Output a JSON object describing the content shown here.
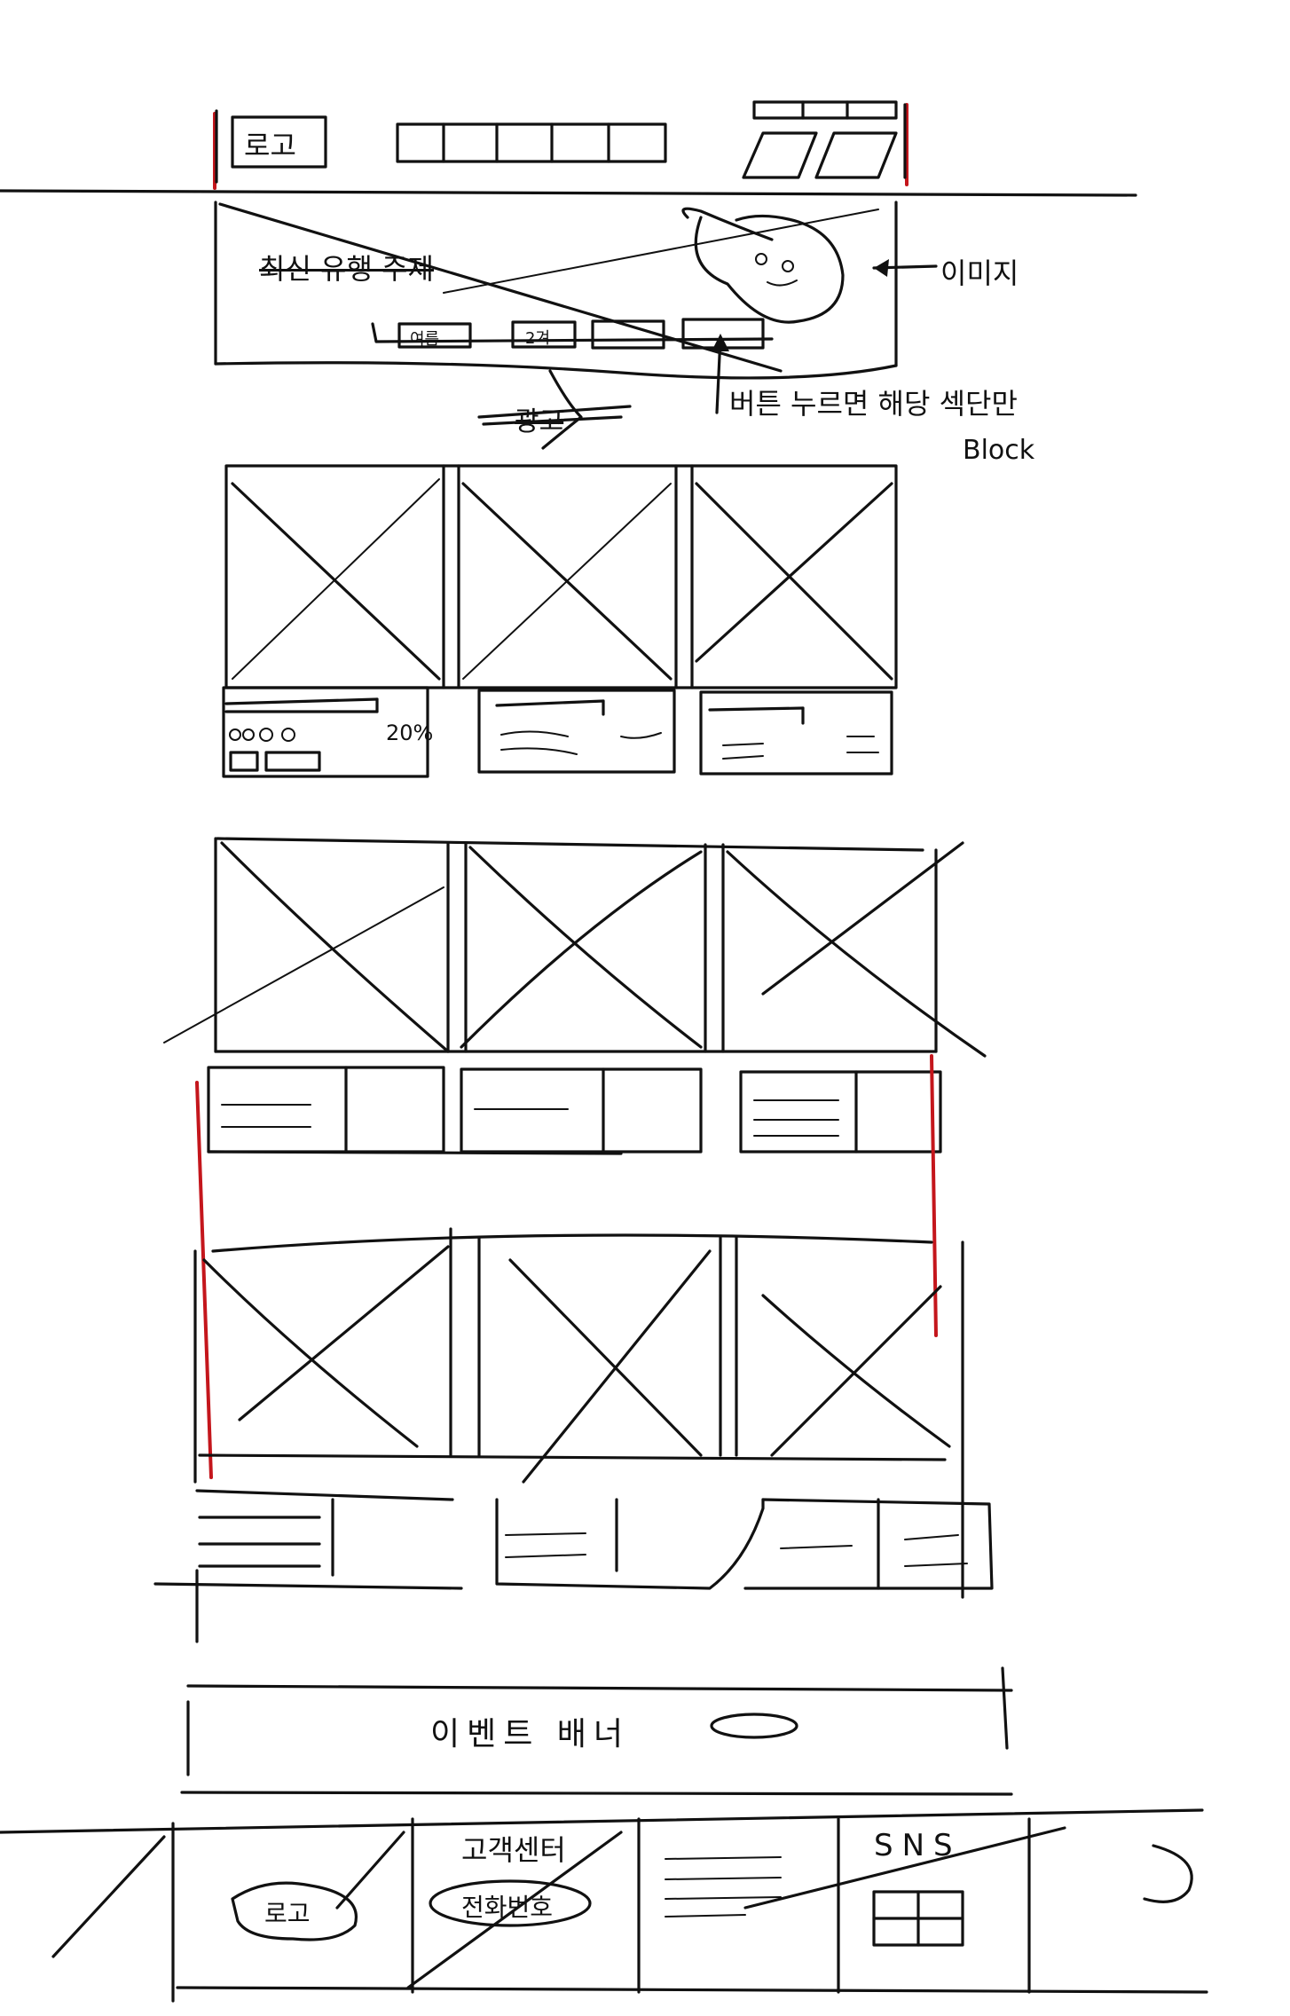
{
  "header": {
    "logo_label": "로고"
  },
  "hero": {
    "title_struck": "최신 유행 주제",
    "button_labels": [
      "여름",
      "2겨"
    ],
    "below_struck": "광고"
  },
  "annotations": {
    "image_note": "이미지",
    "button_note_line1": "버튼 누르면 해당 섹단만",
    "button_note_line2": "Block"
  },
  "product_section_1": {
    "discount_text": "20%"
  },
  "event_banner": {
    "label": "이벤트 배너"
  },
  "footer": {
    "logo_label": "로고",
    "customer_center_label": "고객센터",
    "phone_label": "전화번호",
    "sns_label": "SNS"
  }
}
